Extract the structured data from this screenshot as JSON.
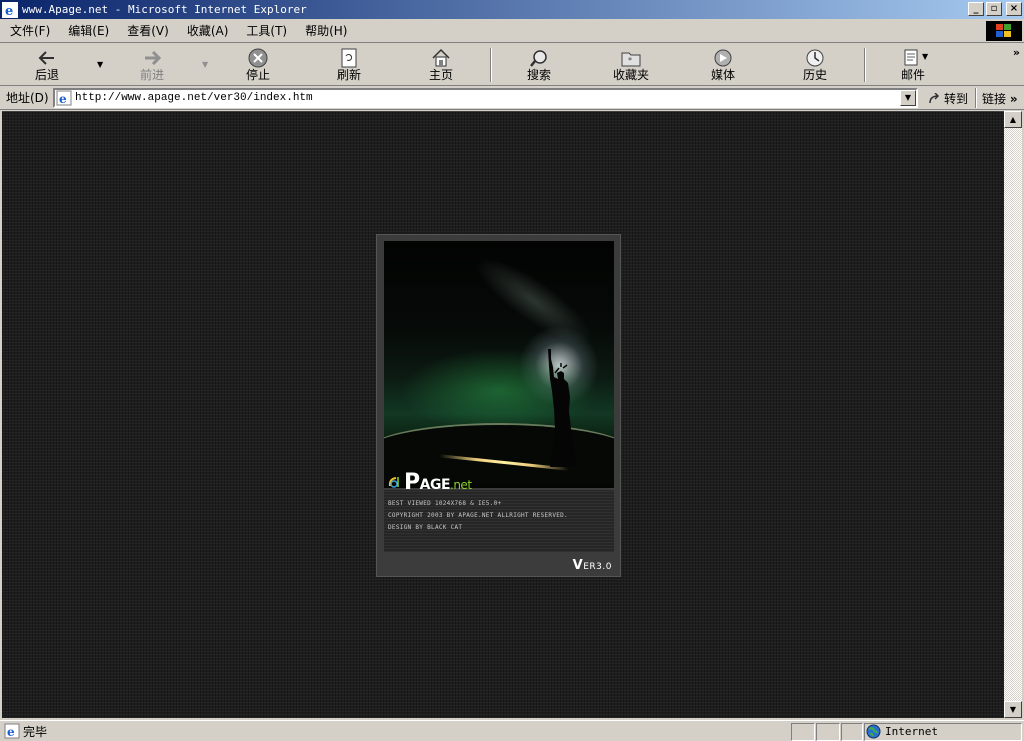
{
  "window": {
    "title": "www.Apage.net - Microsoft Internet Explorer",
    "buttons": [
      "minimize",
      "restore",
      "close"
    ]
  },
  "menu": {
    "items": [
      "文件(F)",
      "编辑(E)",
      "查看(V)",
      "收藏(A)",
      "工具(T)",
      "帮助(H)"
    ]
  },
  "toolbar": {
    "back": "后退",
    "forward": "前进",
    "stop": "停止",
    "refresh": "刷新",
    "home": "主页",
    "search": "搜索",
    "favorites": "收藏夹",
    "media": "媒体",
    "history": "历史",
    "mail": "邮件",
    "more": "»"
  },
  "address": {
    "label": "地址(D)",
    "url": "http://www.apage.net/ver30/index.htm",
    "go_label": "转到",
    "links_label": "链接",
    "links_more": "»"
  },
  "page": {
    "logo_p": "P",
    "logo_age": "AGE",
    "logo_net": ".net",
    "info": [
      "BEST VIEWED 1024X768 & IE5.0+",
      "COPYRIGHT 2003 BY APAGE.NET ALLRIGHT RESERVED.",
      "DESIGN BY BLACK CAT"
    ],
    "version_v": "V",
    "version_rest": "ER3.0"
  },
  "status": {
    "text": "完毕",
    "zone": "Internet"
  }
}
